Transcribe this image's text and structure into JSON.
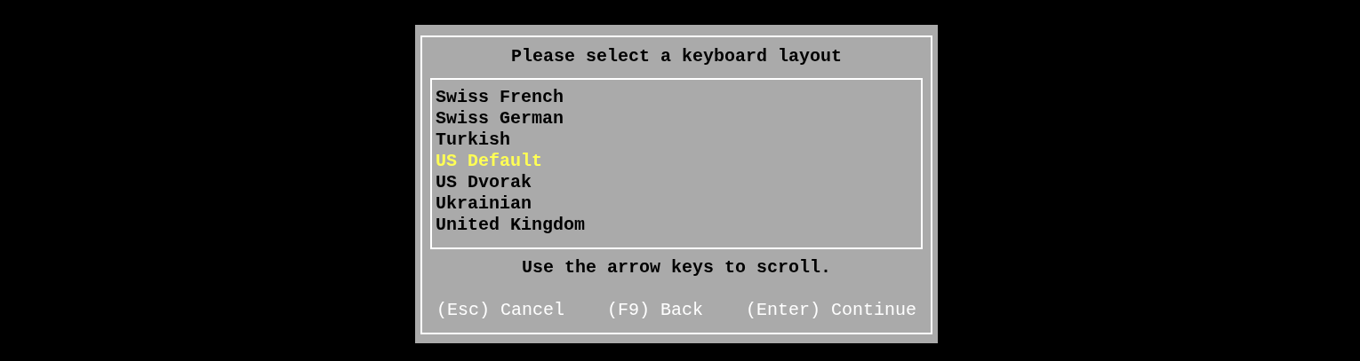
{
  "dialog": {
    "title": "Please select a keyboard layout",
    "items": [
      {
        "label": "Swiss French",
        "selected": false
      },
      {
        "label": "Swiss German",
        "selected": false
      },
      {
        "label": "Turkish",
        "selected": false
      },
      {
        "label": "US Default",
        "selected": true
      },
      {
        "label": "US Dvorak",
        "selected": false
      },
      {
        "label": "Ukrainian",
        "selected": false
      },
      {
        "label": "United Kingdom",
        "selected": false
      }
    ],
    "hint": "Use the arrow keys to scroll.",
    "actions": [
      "(Esc) Cancel",
      "(F9) Back",
      "(Enter) Continue"
    ]
  }
}
